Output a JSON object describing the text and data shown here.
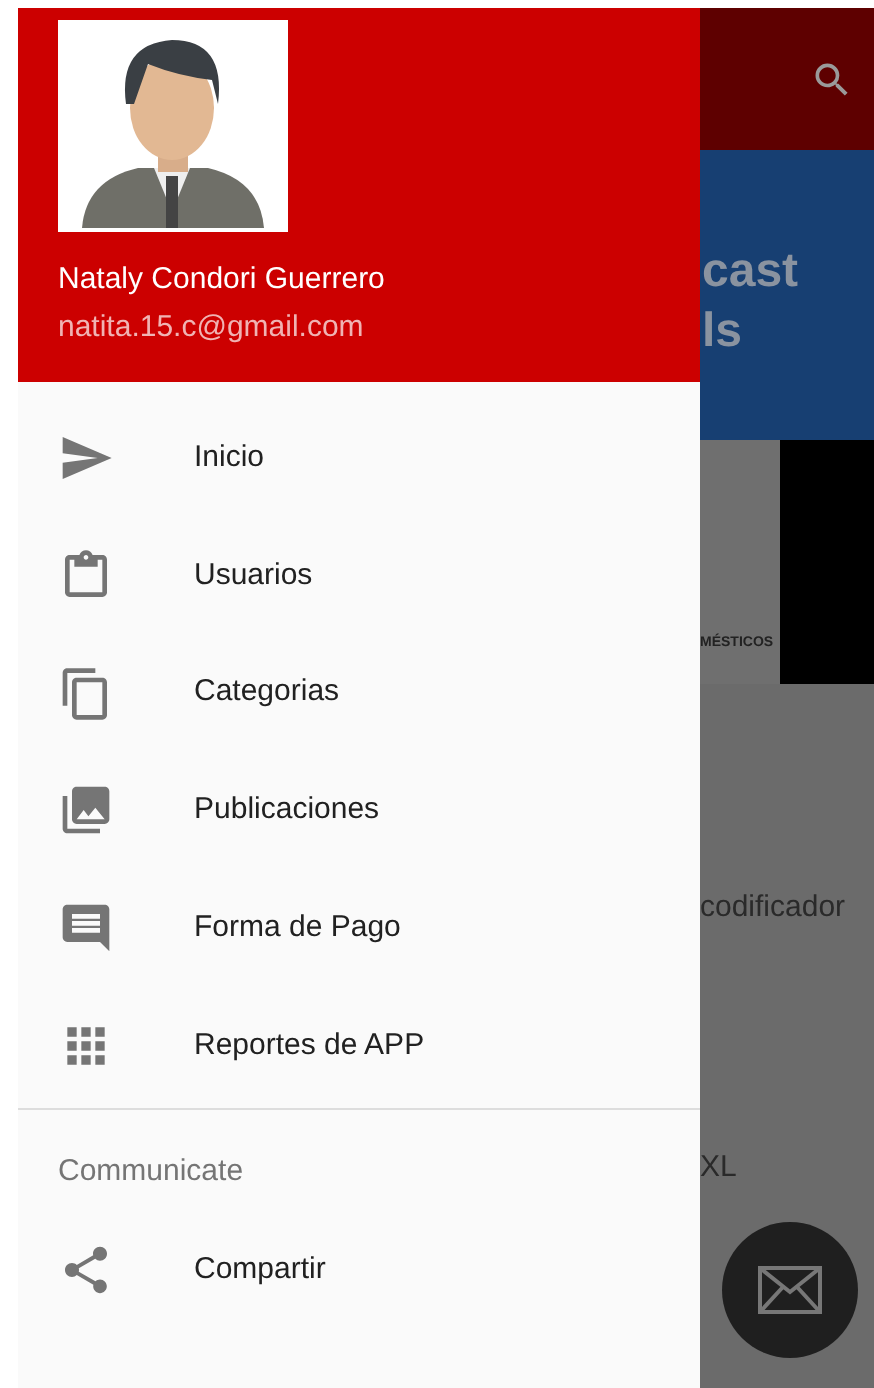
{
  "drawer": {
    "user": {
      "name": "Nataly Condori Guerrero",
      "email": "natita.15.c@gmail.com"
    },
    "items": [
      {
        "label": "Inicio"
      },
      {
        "label": "Usuarios"
      },
      {
        "label": "Categorias"
      },
      {
        "label": "Publicaciones"
      },
      {
        "label": "Forma de Pago"
      },
      {
        "label": "Reportes de APP"
      }
    ],
    "section": {
      "title": "Communicate",
      "items": [
        {
          "label": "Compartir"
        }
      ]
    }
  },
  "background": {
    "banner_lines": [
      "cast",
      "ls"
    ],
    "ad_text": "MÉSTICOS",
    "list_texts": [
      "codificador",
      "XL"
    ]
  }
}
